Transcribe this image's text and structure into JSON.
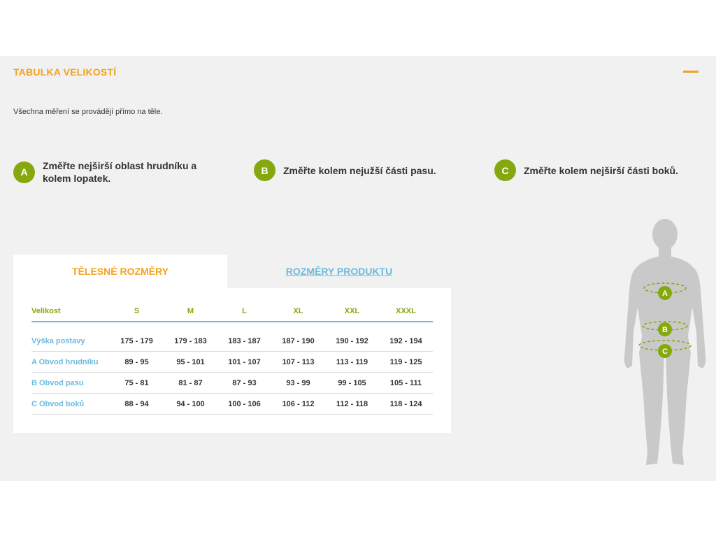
{
  "header": {
    "title": "TABULKA VELIKOSTÍ",
    "collapse_icon": "minus-icon",
    "accent_color": "#f5a11a"
  },
  "intro": "Všechna měření se provádějí přímo na těle.",
  "measures": [
    {
      "badge": "A",
      "text": "Změřte nejširší oblast hrudníku a kolem lopatek."
    },
    {
      "badge": "B",
      "text": "Změřte kolem nejužší části pasu."
    },
    {
      "badge": "C",
      "text": "Změřte kolem nejširší části boků."
    }
  ],
  "tabs": [
    {
      "label": "TĚLESNÉ ROZMĚRY",
      "active": true
    },
    {
      "label": "ROZMĚRY PRODUKTU",
      "active": false
    }
  ],
  "table": {
    "headers": [
      "Velikost",
      "S",
      "M",
      "L",
      "XL",
      "XXL",
      "XXXL"
    ],
    "rows": [
      [
        "Výška postavy",
        "175 - 179",
        "179 - 183",
        "183 - 187",
        "187 - 190",
        "190 - 192",
        "192 - 194"
      ],
      [
        "A Obvod hrudníku",
        "89 - 95",
        "95 - 101",
        "101 - 107",
        "107 - 113",
        "113 - 119",
        "119 - 125"
      ],
      [
        "B Obvod pasu",
        "75 - 81",
        "81 - 87",
        "87 - 93",
        "93 - 99",
        "99 - 105",
        "105 - 111"
      ],
      [
        "C Obvod boků",
        "88 - 94",
        "94 - 100",
        "100 - 106",
        "106 - 112",
        "112 - 118",
        "118 - 124"
      ]
    ]
  },
  "figure": {
    "markers": [
      "A",
      "B",
      "C"
    ],
    "marker_color": "#86a80f"
  }
}
